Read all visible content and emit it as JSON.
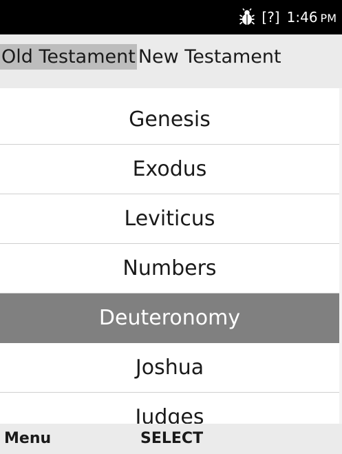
{
  "status_bar": {
    "bug_icon": "bug-icon",
    "signal_text": "[?]",
    "time": "1:46",
    "ampm": "PM"
  },
  "tabs": [
    {
      "label": "Old Testament",
      "active": true
    },
    {
      "label": "New Testament",
      "active": false
    }
  ],
  "books": [
    {
      "label": "Genesis"
    },
    {
      "label": "Exodus"
    },
    {
      "label": "Leviticus"
    },
    {
      "label": "Numbers"
    },
    {
      "label": "Deuteronomy",
      "selected": true
    },
    {
      "label": "Joshua"
    },
    {
      "label": "Judges"
    }
  ],
  "softkeys": {
    "left": "Menu",
    "center": "SELECT"
  },
  "colors": {
    "status_bg": "#000000",
    "tab_bg": "#ebebeb",
    "tab_active_bg": "#bdbdbd",
    "selected_bg": "#808080",
    "softkey_bg": "#ebebeb"
  }
}
